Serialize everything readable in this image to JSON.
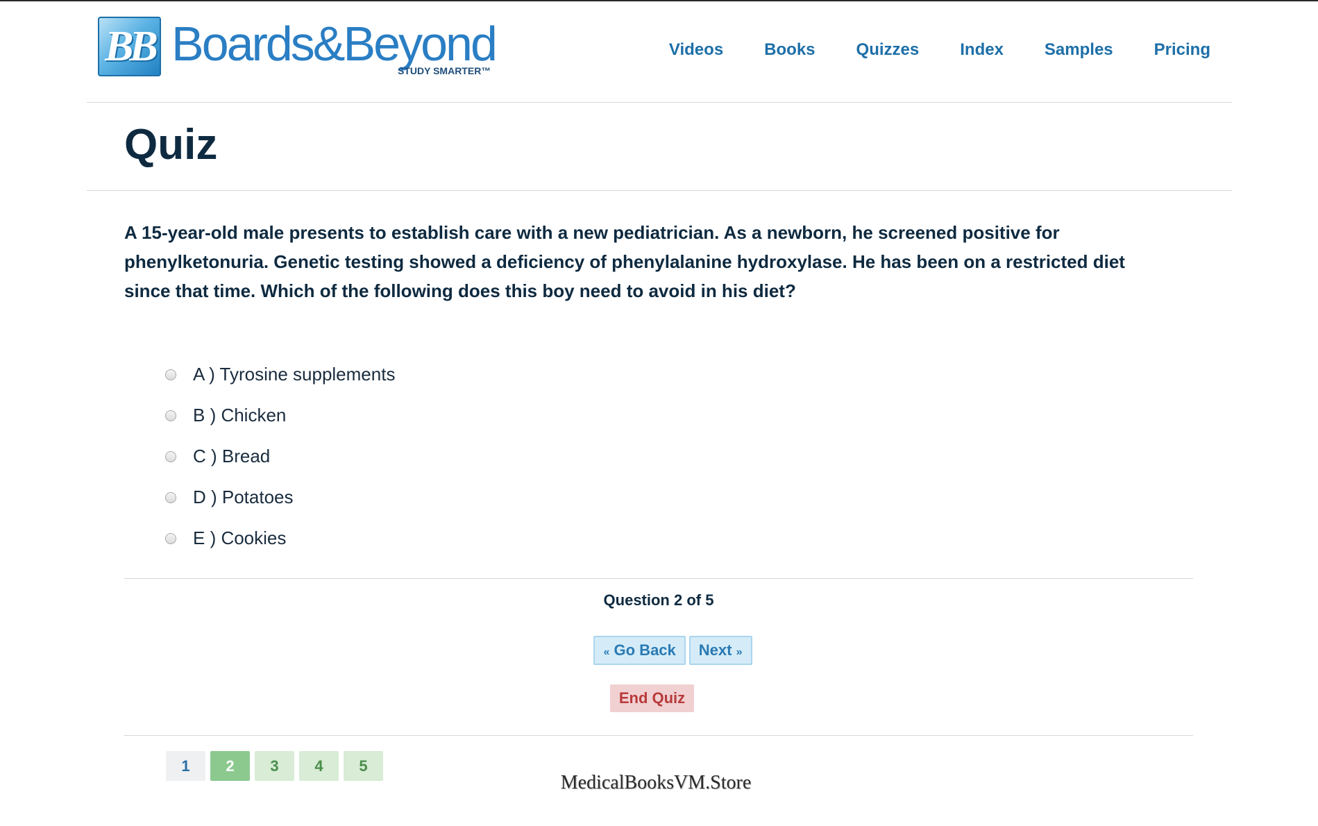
{
  "header": {
    "logo": {
      "mark": "BB",
      "wordmark": "Boards&Beyond",
      "tagline": "STUDY SMARTER™"
    },
    "nav": [
      "Videos",
      "Books",
      "Quizzes",
      "Index",
      "Samples",
      "Pricing"
    ]
  },
  "page": {
    "title": "Quiz"
  },
  "question": {
    "text": "A 15-year-old male presents to establish care with a new pediatrician. As a newborn, he screened positive for phenylketonuria. Genetic testing showed a deficiency of phenylalanine hydroxylase. He has been on a restricted diet since that time. Which of the following does this boy need to avoid in his diet?",
    "answers": [
      "A ) Tyrosine supplements",
      "B ) Chicken",
      "C ) Bread",
      "D ) Potatoes",
      "E ) Cookies"
    ]
  },
  "progress": {
    "text": "Question 2 of 5"
  },
  "buttons": {
    "back_arrow": "«",
    "back": "Go Back",
    "next": "Next",
    "next_arrow": "»",
    "end": "End Quiz"
  },
  "pager": [
    "1",
    "2",
    "3",
    "4",
    "5"
  ],
  "watermark": "MedicalBooksVM.Store",
  "colors": {
    "brand_blue": "#2a7ec4",
    "heading": "#0e2a40",
    "current_page": "#8cc98f",
    "end_button": "#f1d0d2"
  }
}
